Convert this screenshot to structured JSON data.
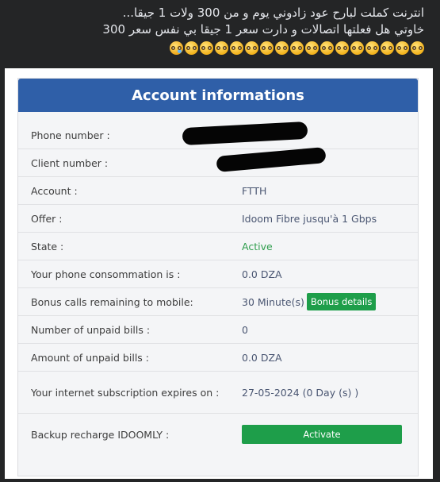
{
  "post": {
    "line1": "انترنت كملت لبارح عود زادوني يوم و من 300 ولات 1 جيقا...",
    "line2": "خاوتي هل فعلتها اتصالات و دارت سعر 1 جيقا بي نفس سعر 300",
    "emoji_count": 17,
    "emoji_icon": "flushed-face-emoji",
    "last_emoji_icon": "crying-face-emoji"
  },
  "account": {
    "title": "Account informations",
    "rows": [
      {
        "label": "Phone number :",
        "value": ""
      },
      {
        "label": "Client number :",
        "value": ""
      },
      {
        "label": "Account :",
        "value": "FTTH"
      },
      {
        "label": "Offer :",
        "value": "Idoom Fibre jusqu'à 1 Gbps"
      },
      {
        "label": "State :",
        "value": "Active"
      },
      {
        "label": "Your phone consommation is :",
        "value": "0.0 DZA"
      },
      {
        "label": "Bonus calls remaining to mobile:",
        "value": "30 Minute(s)"
      },
      {
        "label": "Number of unpaid bills :",
        "value": "0"
      },
      {
        "label": "Amount of unpaid bills :",
        "value": "0.0 DZA"
      },
      {
        "label": "Your internet subscription expires on :",
        "value": "27-05-2024 (0 Day (s) )"
      },
      {
        "label": "Backup recharge IDOOMLY :",
        "value": ""
      }
    ],
    "bonus_button": "Bonus details",
    "activate_button": "Activate"
  },
  "colors": {
    "header_blue": "#2f5fa8",
    "button_green": "#1e9e4a",
    "active_green": "#2e9d4c"
  }
}
